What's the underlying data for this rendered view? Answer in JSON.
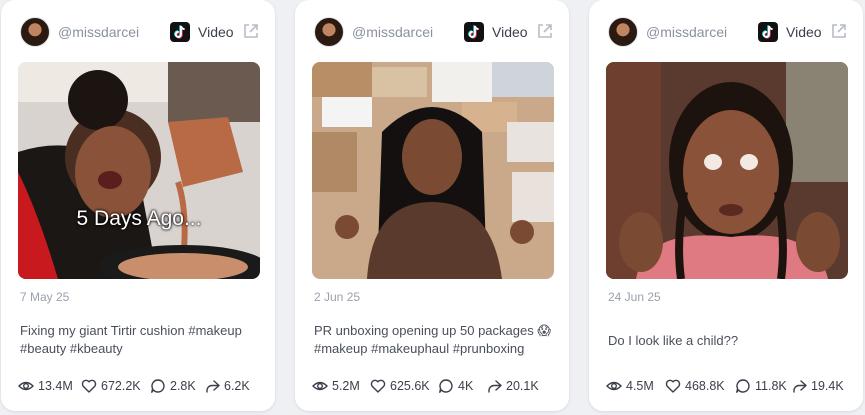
{
  "cards": [
    {
      "username": "@missdarcei",
      "type_label": "Video",
      "overlay": "5 Days Ago...",
      "date": "7 May 25",
      "caption_line1": "Fixing my giant Tirtir cushion #makeup",
      "caption_line2": "#beauty #kbeauty",
      "views": "13.4M",
      "likes": "672.2K",
      "comments": "2.8K",
      "shares": "6.2K"
    },
    {
      "username": "@missdarcei",
      "type_label": "Video",
      "date": "2 Jun 25",
      "caption_line1": "PR unboxing opening up 50 packages 😱",
      "caption_line2": "#makeup #makeuphaul #prunboxing",
      "views": "5.2M",
      "likes": "625.6K",
      "comments": "4K",
      "shares": "20.1K"
    },
    {
      "username": "@missdarcei",
      "type_label": "Video",
      "date": "24 Jun 25",
      "caption_line1": "Do I look like a child??",
      "views": "4.5M",
      "likes": "468.8K",
      "comments": "11.8K",
      "shares": "19.4K"
    }
  ],
  "icons": {
    "platform": "tiktok-icon",
    "external": "external-link-icon",
    "views": "eye-icon",
    "likes": "heart-icon",
    "comments": "comment-icon",
    "shares": "share-icon"
  }
}
